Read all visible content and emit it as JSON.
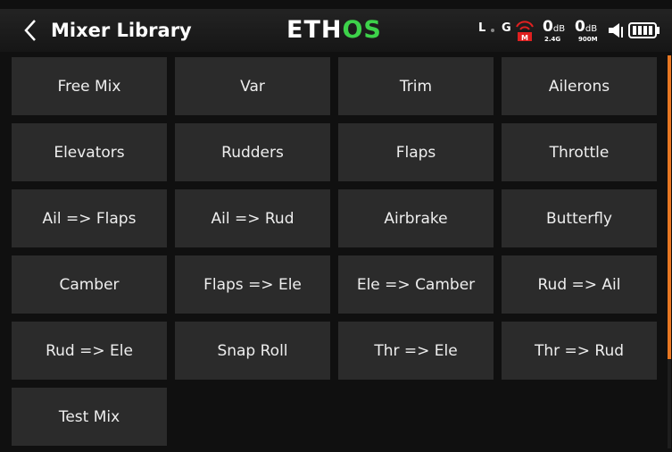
{
  "header": {
    "title": "Mixer Library",
    "logo_prefix": "ETH",
    "logo_suffix": "OS",
    "back_icon": "chevron-left-icon"
  },
  "status": {
    "telemetry_L": "L",
    "telemetry_G": "G",
    "rssi_24": "0",
    "rssi_24_unit": "dB",
    "band_24": "2.4G",
    "rssi_900": "0",
    "rssi_900_unit": "dB",
    "band_900": "900M",
    "icons": [
      "telemetry-L-icon",
      "telemetry-G-icon",
      "rf-module-icon",
      "volume-icon",
      "battery-icon"
    ],
    "colors": {
      "rf_icon": "#e02020",
      "logo_accent": "#3dd24a",
      "scroll_accent": "#e87722"
    }
  },
  "mixers": [
    [
      "Free Mix",
      "Var",
      "Trim",
      "Ailerons"
    ],
    [
      "Elevators",
      "Rudders",
      "Flaps",
      "Throttle"
    ],
    [
      "Ail => Flaps",
      "Ail => Rud",
      "Airbrake",
      "Butterfly"
    ],
    [
      "Camber",
      "Flaps => Ele",
      "Ele => Camber",
      "Rud => Ail"
    ],
    [
      "Rud => Ele",
      "Snap Roll",
      "Thr => Ele",
      "Thr => Rud"
    ],
    [
      "Test Mix"
    ]
  ]
}
